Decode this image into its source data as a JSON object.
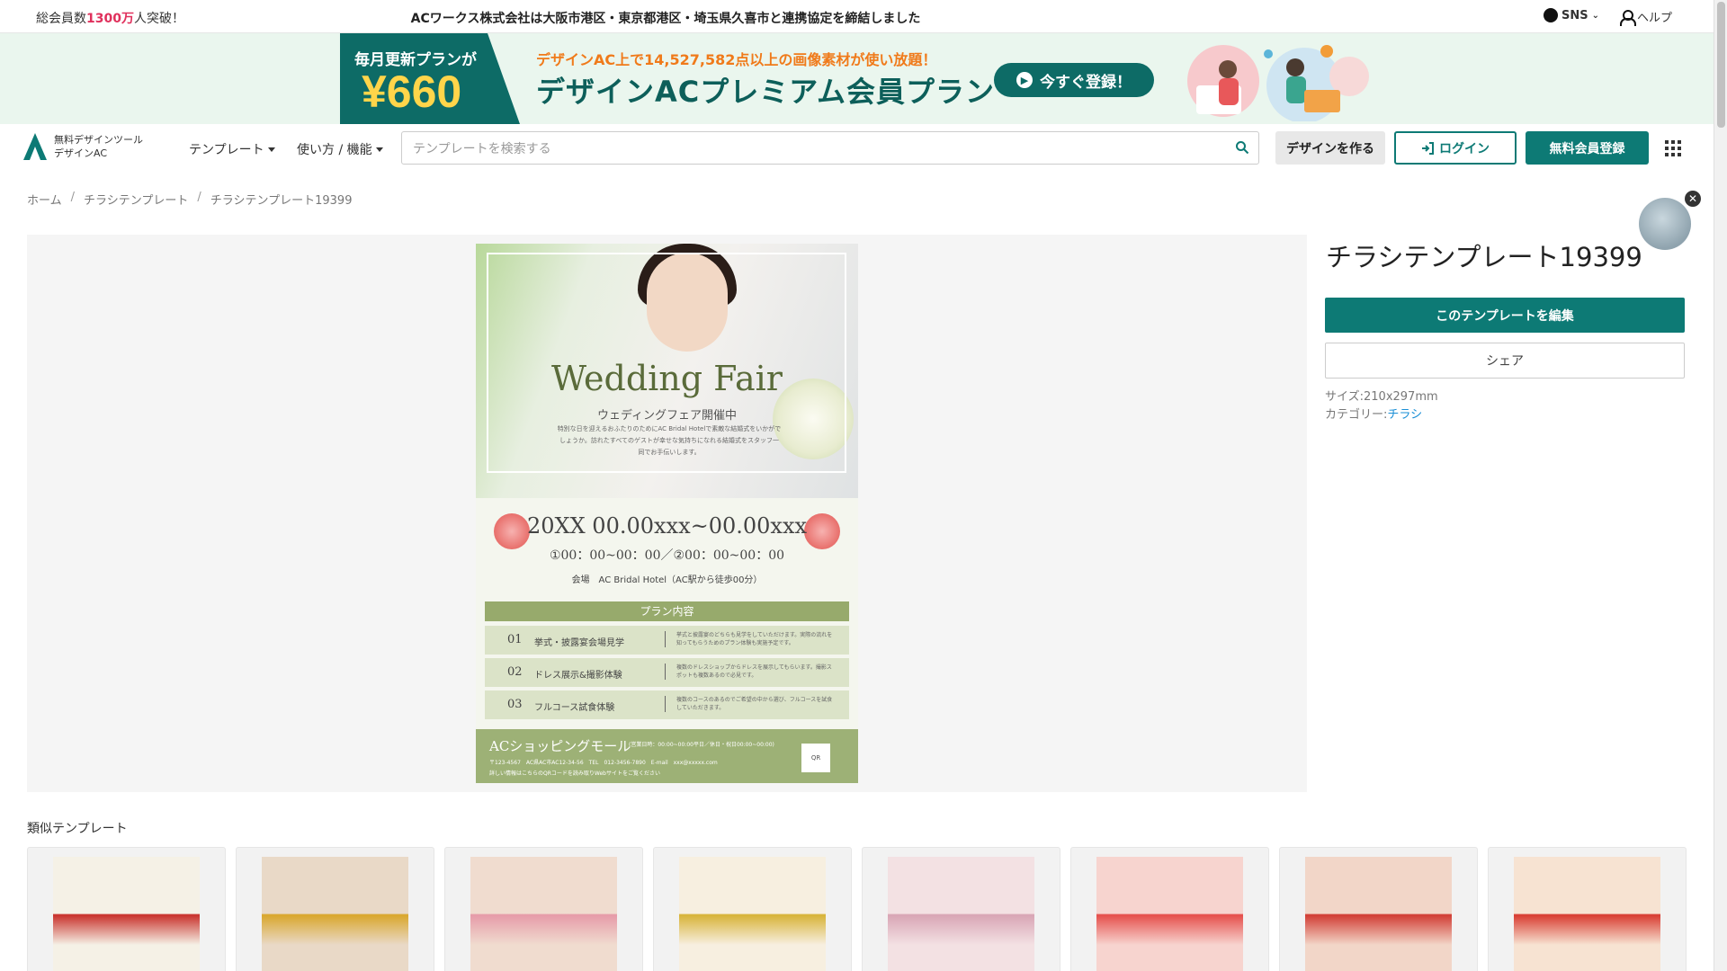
{
  "topbar": {
    "members_prefix": "総会員数",
    "members_num": "1300万",
    "members_suffix": "人突破！",
    "news": "ACワークス株式会社は大阪市港区・東京都港区・埼玉県久喜市と連携協定を締結しました",
    "sns_label": "SNS",
    "help_label": "ヘルプ"
  },
  "banner": {
    "plan_label": "毎月更新プランが",
    "price": "¥660",
    "sub": "デザインAC上で14,527,582点以上の画像素材が使い放題！",
    "main": "デザインACプレミアム会員プラン",
    "cta": "今すぐ登録！"
  },
  "nav": {
    "logo_line1": "無料デザインツール",
    "logo_line2": "デザインAC",
    "templates": "テンプレート",
    "howto": "使い方 / 機能",
    "search_placeholder": "テンプレートを検索する",
    "create": "デザインを作る",
    "login": "ログイン",
    "register": "無料会員登録"
  },
  "breadcrumb": [
    "ホーム",
    "チラシテンプレート",
    "チラシテンプレート19399"
  ],
  "flyer": {
    "title": "Wedding Fair",
    "subtitle": "ウェディングフェア開催中",
    "desc": "特別な日を迎えるおふたりのためにAC Bridal Hotelで素敵な結婚式をいかがでしょうか。訪れたすべてのゲストが幸せな気持ちになれる結婚式をスタッフ一同でお手伝いします。",
    "date": "20XX 00.00xxx~00.00xxx",
    "time": "①00：00~00：00／②00：00~00：00",
    "venue": "会場　AC Bridal Hotel（AC駅から徒歩00分）",
    "plan_head": "プラン内容",
    "plans": [
      {
        "no": "01",
        "title": "挙式・披露宴会場見学",
        "desc": "挙式と披露宴のどちらも見学をしていただけます。実際の流れを知ってもらうためのプラン体験も実施予定です。"
      },
      {
        "no": "02",
        "title": "ドレス展示&撮影体験",
        "desc": "複数のドレスショップからドレスを展示してもらいます。撮影スポットも複数あるので必見です。"
      },
      {
        "no": "03",
        "title": "フルコース試食体験",
        "desc": "複数のコースのあるのでご希望の中から選び、フルコースを試食していただきます。"
      }
    ],
    "footer_name": "ACショッピングモール",
    "footer_hours": "(営業日時：00:00~00:00平日／休日・祝日00:00~00:00)",
    "footer_addr": "〒123-4567　AC県AC市AC12-34-56　TEL　012-3456-7890　E-mail　xxx@xxxxx.com",
    "footer_info": "詳しい情報はこちらのQRコードを読み取りWebサイトをご覧ください",
    "qr": "QR"
  },
  "detail": {
    "title": "チラシテンプレート19399",
    "edit": "このテンプレートを編集",
    "share": "シェア",
    "size_label": "サイズ:",
    "size_value": "210x297mm",
    "category_label": "カテゴリー:",
    "category_value": "チラシ"
  },
  "similar": {
    "title": "類似テンプレート",
    "thumb_colors": [
      "#f5f1e6",
      "#e9d9c7",
      "#f0dccf",
      "#f7efe0",
      "#f3e1e3",
      "#f7d4cf",
      "#f2d6c8",
      "#f7e3d2"
    ],
    "thumb_accents": [
      "#c8302a",
      "#d9a62a",
      "#e69aa8",
      "#d7b236",
      "#d8a4b4",
      "#e54d4a",
      "#d13b32",
      "#d83a2f"
    ]
  },
  "icons": {
    "search": "search-icon",
    "grid": "grid-menu-icon",
    "login": "login-arrow-icon",
    "user": "user-icon",
    "sns": "sns-bubble-icon"
  }
}
